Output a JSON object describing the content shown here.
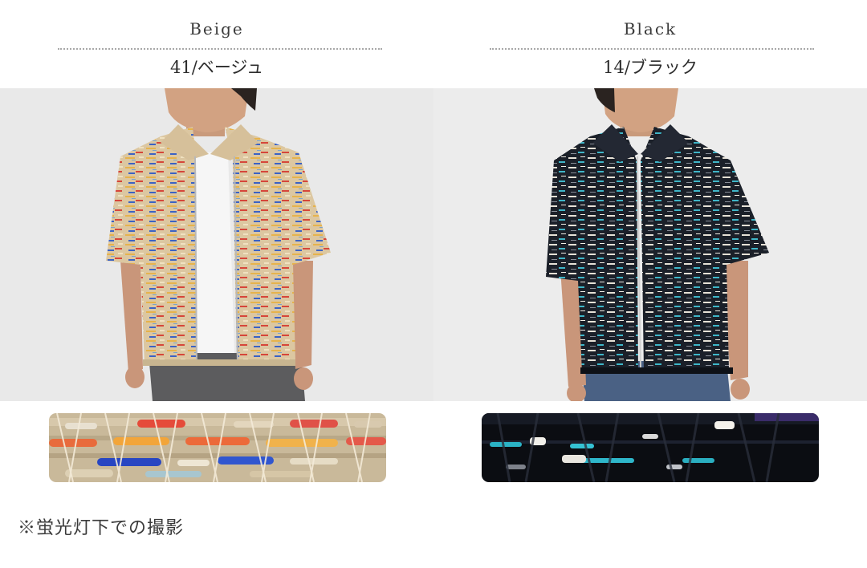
{
  "colors": {
    "beige": {
      "name_en": "Beige",
      "code_label": "41/ベージュ",
      "photo_alt": "beige-knit-shirt",
      "accent": "#d8c39a"
    },
    "black": {
      "name_en": "Black",
      "code_label": "14/ブラック",
      "photo_alt": "black-knit-shirt",
      "accent": "#1a1f2a"
    }
  },
  "note": "※蛍光灯下での撮影"
}
